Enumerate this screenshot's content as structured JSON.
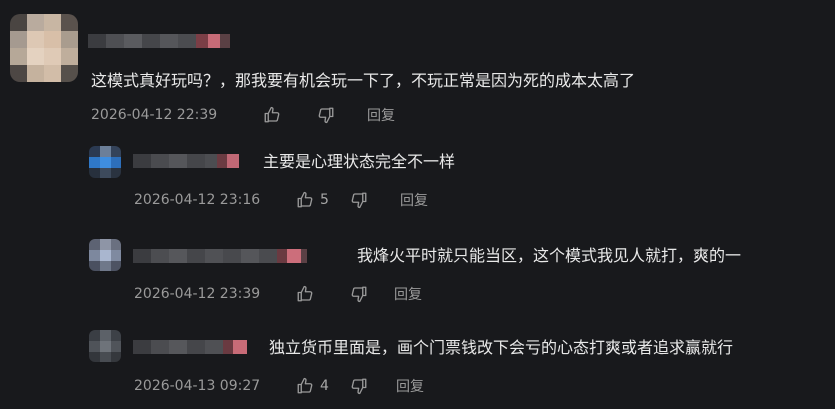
{
  "comments": [
    {
      "text": "这模式真好玩吗？，那我要有机会玩一下了，不玩正常是因为死的成本太高了",
      "time": "2026-04-12 22:39",
      "likes": "",
      "reply": "回复"
    },
    {
      "text": "主要是心理状态完全不一样",
      "time": "2026-04-12 23:16",
      "likes": "5",
      "reply": "回复"
    },
    {
      "text": "我烽火平时就只能当区，这个模式我见人就打，爽的一",
      "time": "2026-04-12 23:39",
      "likes": "",
      "reply": "回复"
    },
    {
      "text": "独立货币里面是，画个门票钱改下会亏的心态打爽或者追求赢就行",
      "time": "2026-04-13 09:27",
      "likes": "4",
      "reply": "回复"
    }
  ],
  "icons": {
    "like": "thumbs-up-icon",
    "dislike": "thumbs-down-icon"
  },
  "colors": {
    "background": "#18191c",
    "text": "#e9e9e9",
    "meta": "#9a9a9a"
  }
}
